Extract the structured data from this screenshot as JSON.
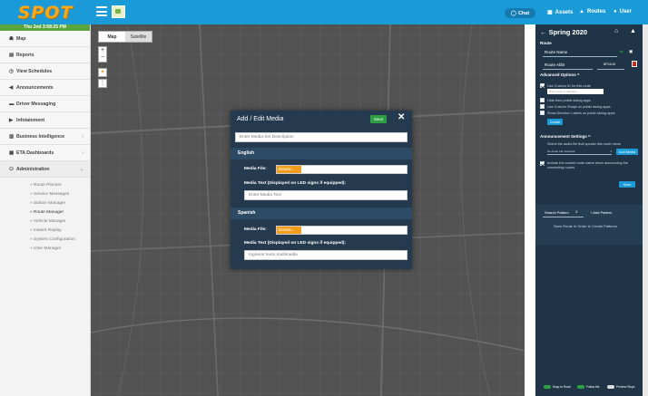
{
  "app": {
    "logo": "SPOT"
  },
  "topbar": {
    "chat_label": "Chat",
    "assets_label": "Assets",
    "routes_label": "Routes",
    "user_label": "User"
  },
  "sidebar": {
    "datetime": "Thu 2nd 3:58:25 PM",
    "items": [
      {
        "label": "Map",
        "icon": "map-icon"
      },
      {
        "label": "Reports",
        "icon": "chart-icon"
      },
      {
        "label": "View Schedules",
        "icon": "clock-icon"
      },
      {
        "label": "Announcements",
        "icon": "megaphone-icon"
      },
      {
        "label": "Driver Messaging",
        "icon": "message-icon"
      },
      {
        "label": "Infotainment",
        "icon": "video-icon"
      },
      {
        "label": "Business Intelligence",
        "icon": "bar-chart-icon"
      },
      {
        "label": "ETA Dashboards",
        "icon": "dashboard-icon"
      },
      {
        "label": "Administration",
        "icon": "users-icon"
      }
    ],
    "submenu": [
      "» Route Planner",
      "» Service Messages",
      "» Station Manager",
      "» Route Manager",
      "» Vehicle Manager",
      "» Instant Replay",
      "» System Configuration",
      "» User Manager"
    ]
  },
  "map": {
    "tab_map": "Map",
    "tab_satellite": "Satellite"
  },
  "modal": {
    "title": "Add / Edit Media",
    "save_label": "Save",
    "description_placeholder": "Enter Media Set Description",
    "english": {
      "heading": "English",
      "file_label": "Media File:",
      "browse_label": "Browse...",
      "text_label": "Media Text (Displayed on LED signs if equipped):",
      "text_placeholder": "Enter Media Text"
    },
    "spanish": {
      "heading": "Spanish",
      "file_label": "Media File:",
      "browse_label": "Browse...",
      "text_label": "Media Text (Displayed on LED signs if equipped):",
      "text_placeholder": "Ingresar texto multimedia"
    }
  },
  "panel": {
    "title": "← Spring 2020",
    "route_heading": "Route",
    "route_name_label": "Route Name",
    "route_abbr_label": "Route Abbr",
    "route_color_value": "8F2A10",
    "advanced_heading": "Advanced Options ^",
    "custom_id_label": "Use Custom ID for this route",
    "custom_id_placeholder": "Enter Custom Identifier",
    "hide_label": "Hide from public facing apps",
    "custom_shape_label": "Use Custom Shape on public facing apps",
    "direction_label": "Show Direction Labels on public facing apps",
    "create_label": "Create",
    "announcement_heading": "Announcement Settings ^",
    "audio_hint": "Select the audio file that speaks this route name",
    "audio_select": "No Audio File Selected",
    "add_media_label": "Add Media",
    "include_label": "Include the current route name when announcing the connecting routes.",
    "save_label": "Save",
    "search_pattern_label": "Search Pattern",
    "add_pattern_label": "+ Add Pattern",
    "save_route_hint": "Save Route in Order to Create Patterns",
    "toggle_snap": "Snap to Road",
    "toggle_follow": "Follow Me",
    "toggle_preview": "Preview Stops"
  },
  "colors": {
    "topbar": "#1a9bd7",
    "logo": "#f7a81b",
    "panel": "#1f3447",
    "modal": "#253a4f",
    "save_green": "#2ea043",
    "browse_orange": "#f29c1c",
    "route_color": "#d9261c"
  }
}
